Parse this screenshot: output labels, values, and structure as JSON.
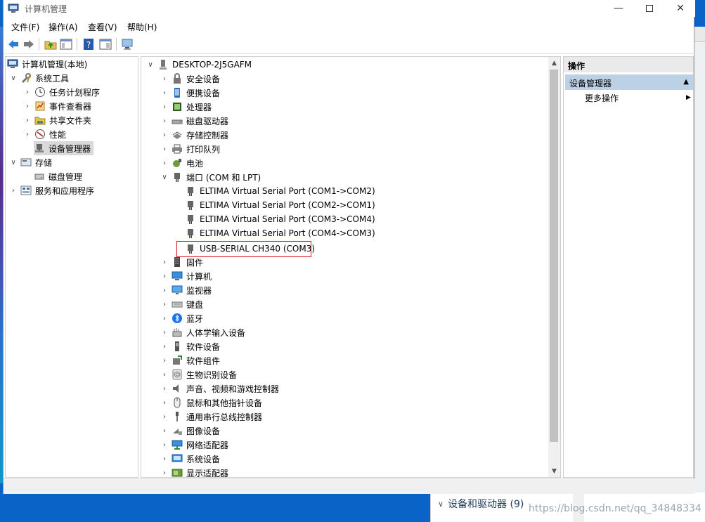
{
  "window": {
    "title": "计算机管理"
  },
  "menubar": {
    "items": [
      "文件(F)",
      "操作(A)",
      "查看(V)",
      "帮助(H)"
    ]
  },
  "left_tree": {
    "root": "计算机管理(本地)",
    "system_tools": "系统工具",
    "system_children": [
      "任务计划程序",
      "事件查看器",
      "共享文件夹",
      "性能",
      "设备管理器"
    ],
    "storage": "存储",
    "storage_children": [
      "磁盘管理"
    ],
    "services": "服务和应用程序"
  },
  "device_tree": {
    "computer": "DESKTOP-2J5GAFM",
    "categories_before": [
      "安全设备",
      "便携设备",
      "处理器",
      "磁盘驱动器",
      "存储控制器",
      "打印队列",
      "电池"
    ],
    "ports_label": "端口 (COM 和 LPT)",
    "ports": [
      "ELTIMA Virtual Serial Port (COM1->COM2)",
      "ELTIMA Virtual Serial Port (COM2->COM1)",
      "ELTIMA Virtual Serial Port (COM3->COM4)",
      "ELTIMA Virtual Serial Port (COM4->COM3)",
      "USB-SERIAL CH340 (COM3)"
    ],
    "categories_after": [
      "固件",
      "计算机",
      "监视器",
      "键盘",
      "蓝牙",
      "人体学输入设备",
      "软件设备",
      "软件组件",
      "生物识别设备",
      "声音、视频和游戏控制器",
      "鼠标和其他指针设备",
      "通用串行总线控制器",
      "图像设备",
      "网络适配器",
      "系统设备",
      "显示适配器"
    ]
  },
  "actions": {
    "header": "操作",
    "group": "设备管理器",
    "more": "更多操作"
  },
  "background": {
    "explorer_row": "设备和驱动器 (9)",
    "watermark": "https://blog.csdn.net/qq_34848334"
  },
  "colors": {
    "highlight": "#d11a2a",
    "selection": "#d9d9d9",
    "actions_group_bg": "#bcd0e6"
  }
}
